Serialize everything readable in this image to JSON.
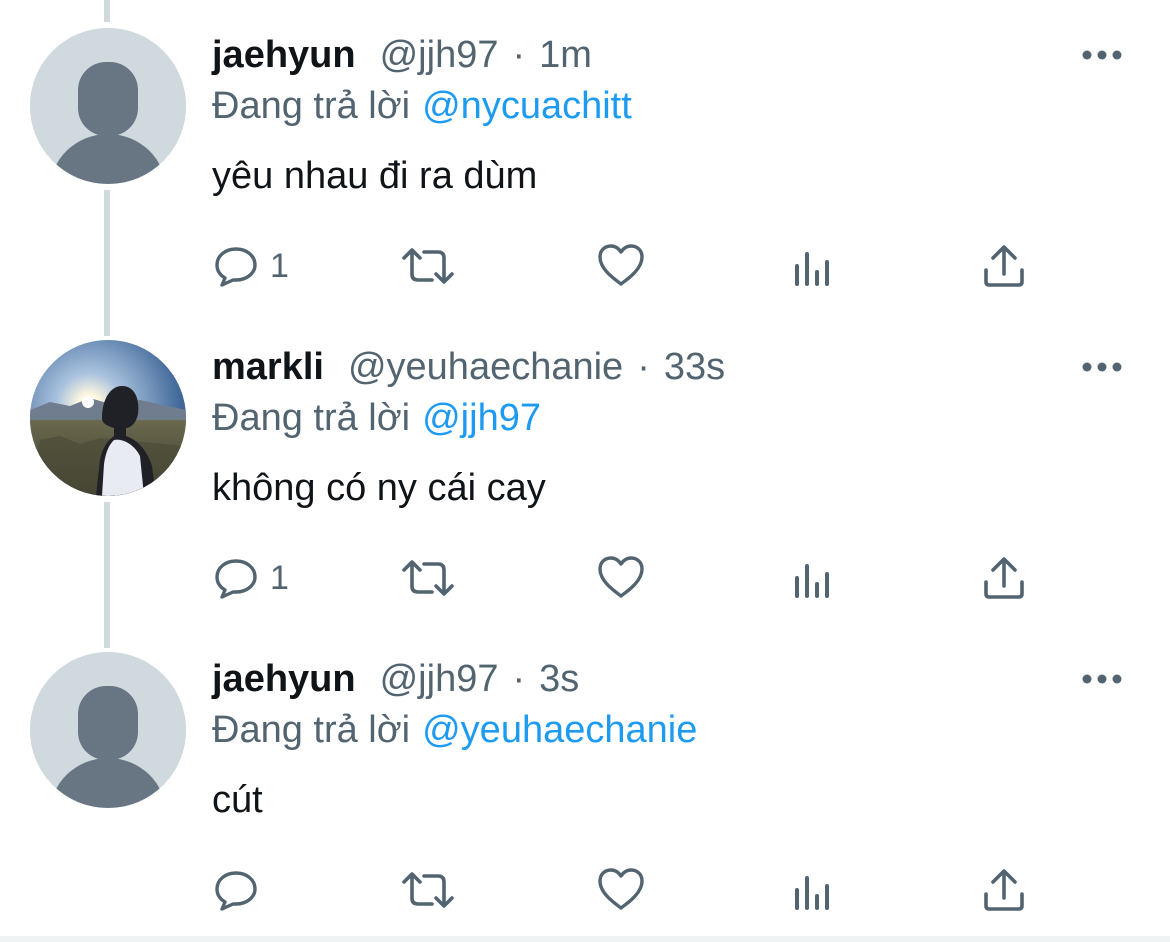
{
  "tweets": [
    {
      "display_name": "jaehyun",
      "handle": "@jjh97",
      "separator": "·",
      "time": "1m",
      "replying_prefix": "Đang trả lời",
      "replying_to": "@nycuachitt",
      "text": "yêu nhau đi ra dùm",
      "reply_count": "1",
      "avatar": "default-avatar"
    },
    {
      "display_name": "markli",
      "handle": "@yeuhaechanie",
      "separator": "·",
      "time": "33s",
      "replying_prefix": "Đang trả lời",
      "replying_to": "@jjh97",
      "text": "không có ny cái cay",
      "reply_count": "1",
      "avatar": "sunset-photo-avatar"
    },
    {
      "display_name": "jaehyun",
      "handle": "@jjh97",
      "separator": "·",
      "time": "3s",
      "replying_prefix": "Đang trả lời",
      "replying_to": "@yeuhaechanie",
      "text": "cút",
      "reply_count": "",
      "avatar": "default-avatar"
    }
  ],
  "icons": {
    "reply": "reply-icon",
    "retweet": "retweet-icon",
    "like": "heart-icon",
    "views": "views-icon",
    "share": "share-icon",
    "more": "more-icon"
  },
  "colors": {
    "primary_text": "#0f1419",
    "secondary_text": "#536471",
    "link": "#1d9bf0",
    "thread_line": "#cfd9de",
    "default_avatar_bg": "#cfd9de",
    "default_avatar_figure": "#687684"
  }
}
